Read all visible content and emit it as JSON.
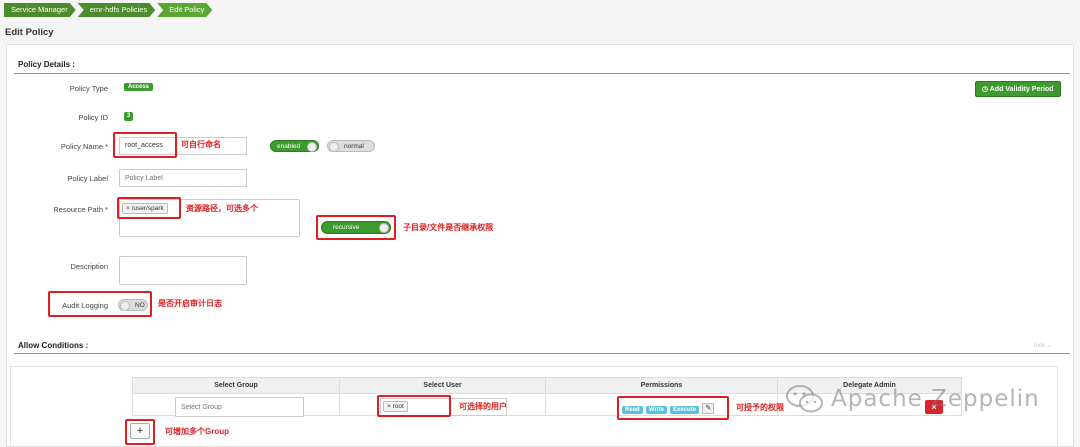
{
  "breadcrumb": [
    "Service Manager",
    "emr-hdfs Policies",
    "Edit Policy"
  ],
  "page_title": "Edit Policy",
  "policy_details": {
    "heading": "Policy Details :",
    "policy_type_label": "Policy Type",
    "policy_type_value": "Access",
    "add_validity_label": "Add Validity Period",
    "policy_id_label": "Policy ID",
    "policy_id_value": "3",
    "policy_name_label": "Policy Name *",
    "policy_name_value": "root_access",
    "enabled_toggle": "enabled",
    "normal_toggle": "normal",
    "policy_label_label": "Policy Label",
    "policy_label_placeholder": "Policy Label",
    "resource_path_label": "Resource Path *",
    "resource_path_tag": "/user/spark",
    "recursive_toggle": "recursive",
    "description_label": "Description",
    "audit_logging_label": "Audit Logging",
    "audit_logging_value": "NO"
  },
  "annotations": {
    "policy_name": "可自行命名",
    "resource_path": "资源路径，可选多个",
    "recursive": "子目录/文件是否继承权限",
    "audit": "是否开启审计日志",
    "user": "可选择的用户",
    "perms": "可授予的权限",
    "group": "可增加多个Group"
  },
  "allow_conditions": {
    "heading": "Allow Conditions :",
    "hide_link": "hide",
    "columns": [
      "Select Group",
      "Select User",
      "Permissions",
      "Delegate Admin"
    ],
    "group_placeholder": "Select Group",
    "user_tag": "root",
    "permissions": [
      "Read",
      "Write",
      "Execute"
    ],
    "add_button": "+",
    "delete_button": "×"
  },
  "watermark": "Apache Zeppelin",
  "colors": {
    "brand_green": "#3d9a2c",
    "annotation_red": "#e02020",
    "permission_blue": "#5bc0de",
    "delete_red": "#d9232d"
  }
}
